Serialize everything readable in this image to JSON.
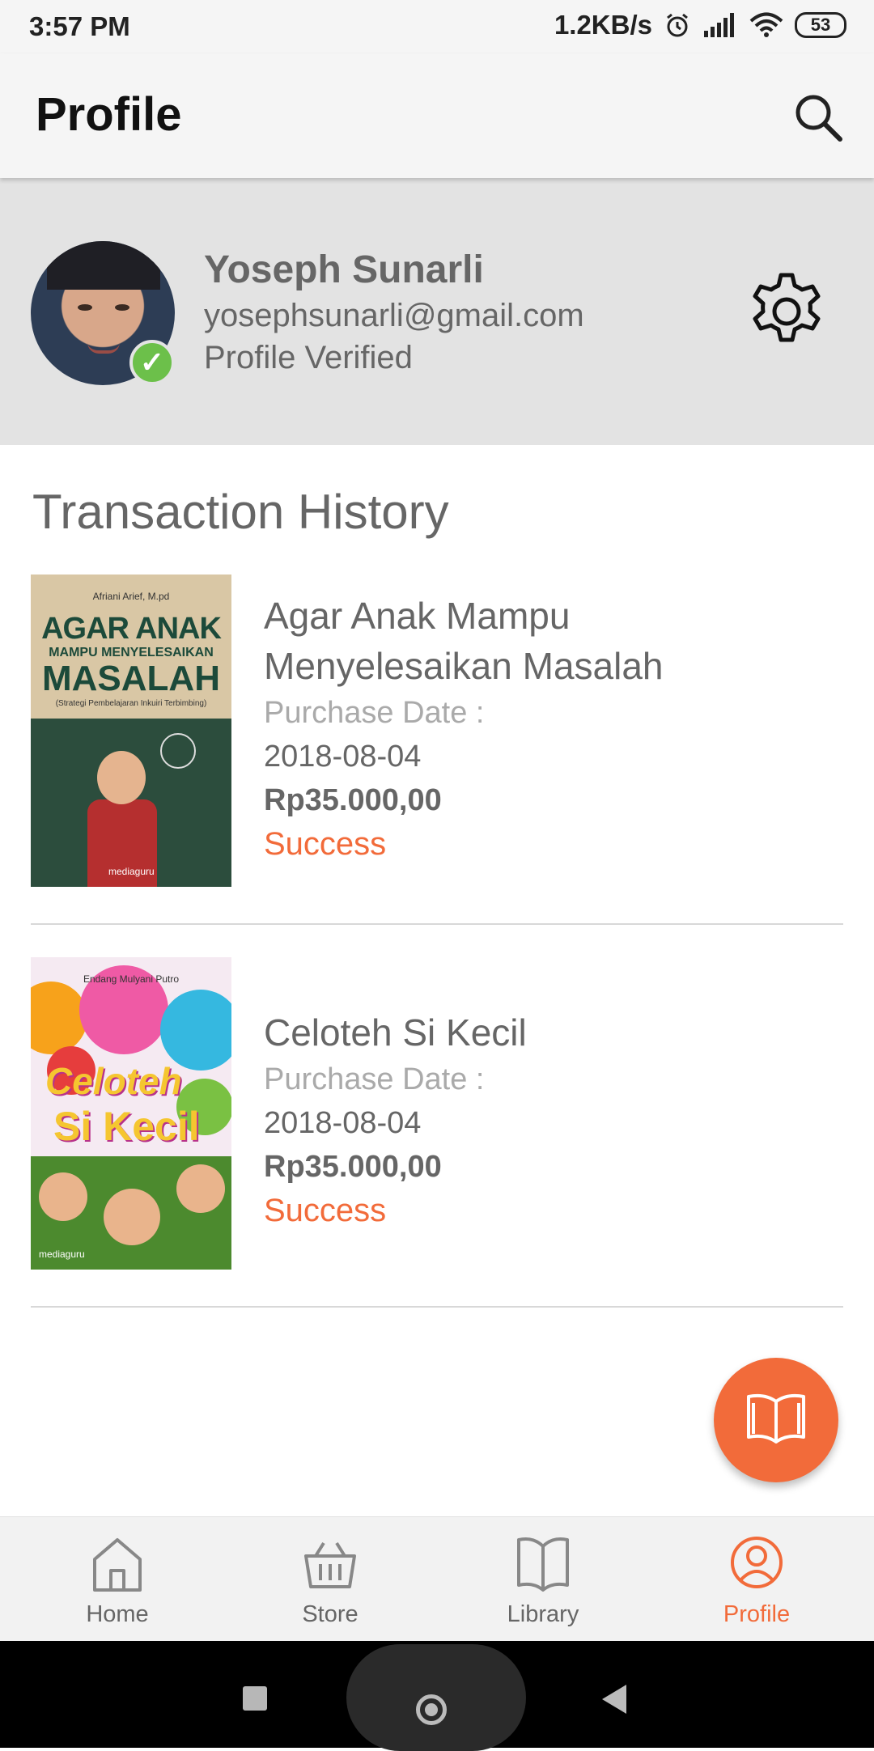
{
  "status_bar": {
    "time": "3:57 PM",
    "network_speed": "1.2KB/s",
    "battery": "53",
    "icons": [
      "alarm-icon",
      "signal-icon",
      "wifi-icon",
      "battery-icon"
    ]
  },
  "app_bar": {
    "title": "Profile",
    "search_icon": "search-icon"
  },
  "profile": {
    "name": "Yoseph Sunarli",
    "email": "yosephsunarli@gmail.com",
    "status": "Profile Verified",
    "settings_icon": "gear-icon"
  },
  "transactions": {
    "title": "Transaction History",
    "items": [
      {
        "title": "Agar Anak Mampu Menyelesaikan Masalah",
        "date_label": "Purchase Date :",
        "date": "2018-08-04",
        "price": "Rp35.000,00",
        "status": "Success",
        "cover": {
          "author": "Afriani Arief, M.pd",
          "line1": "AGAR ANAK",
          "line2": "MAMPU MENYELESAIKAN",
          "line3": "MASALAH",
          "subtitle": "(Strategi Pembelajaran Inkuiri Terbimbing)",
          "publisher": "mediaguru"
        }
      },
      {
        "title": "Celoteh Si Kecil",
        "date_label": "Purchase Date :",
        "date": "2018-08-04",
        "price": "Rp35.000,00",
        "status": "Success",
        "cover": {
          "author": "Endang Mulyani Putro",
          "line1": "Celoteh",
          "line2": "Si Kecil",
          "publisher": "mediaguru"
        }
      }
    ]
  },
  "fab": {
    "icon": "open-book-icon"
  },
  "bottom_nav": {
    "items": [
      {
        "label": "Home",
        "icon": "home-icon"
      },
      {
        "label": "Store",
        "icon": "basket-icon"
      },
      {
        "label": "Library",
        "icon": "book-icon"
      },
      {
        "label": "Profile",
        "icon": "user-icon"
      }
    ],
    "active": "Profile"
  },
  "colors": {
    "accent": "#f26b3a",
    "profile_bg": "#e3e3e3",
    "verified": "#6cc04a",
    "text_secondary": "#666666"
  }
}
